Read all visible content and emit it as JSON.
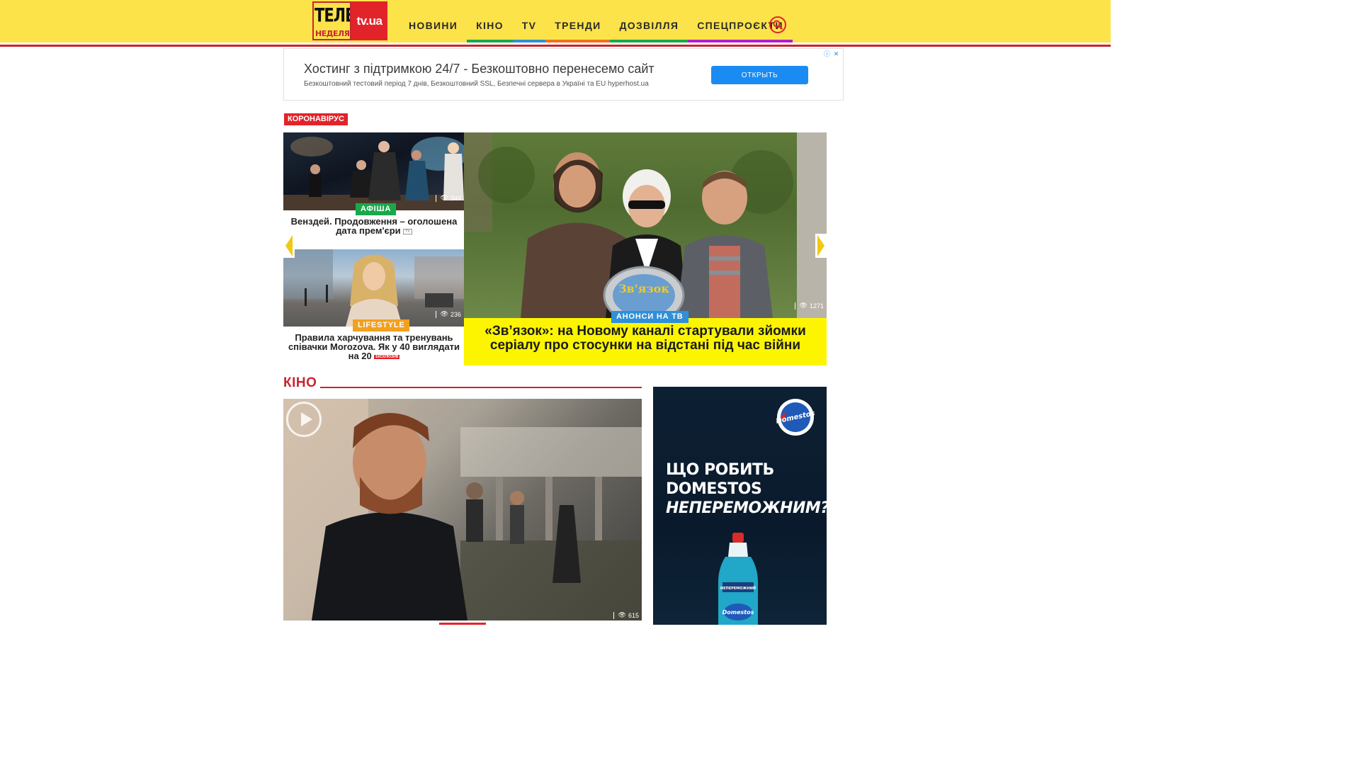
{
  "header": {
    "logo_top": "ТЕЛЕ",
    "logo_bottom": "НЕДЕЛЯ",
    "logo_right": "tv.ua",
    "nav": [
      {
        "label": "НОВИНИ",
        "color": "#fde34a"
      },
      {
        "label": "КІНО",
        "color": "#1aa84c"
      },
      {
        "label": "TV",
        "color": "#2f8fd8"
      },
      {
        "label": "ТРЕНДИ",
        "color": "#f2701f"
      },
      {
        "label": "ДОЗВІЛЛЯ",
        "color": "#1aa84c"
      },
      {
        "label": "СПЕЦПРОЄКТИ",
        "color": "#b31fc9"
      }
    ]
  },
  "ad_top": {
    "title": "Хостинг з підтримкою 24/7 - Безкоштовно перенесемо сайт",
    "subtitle": "Безкоштовний тестовий період 7 днів, Безкоштовний SSL, Безпечні сервера в Україні та EU hyperhost.ua",
    "button": "ОТКРЫТЬ"
  },
  "topic_tag": "КОРОНАВІРУС",
  "slider": {
    "small_cards": [
      {
        "badge": "АФІША",
        "badge_color": "#1aa84c",
        "title": "Венздей. Продовження – оголошена дата прем'єри",
        "mini_tag": "TV",
        "mini_tag_color": "#ffffff",
        "views": "344"
      },
      {
        "badge": "LIFESTYLE",
        "badge_color": "#f2a01f",
        "title": "Правила харчування та тренувань співачки Morozova. Як у 40 виглядати на 20",
        "mini_tag": "ЕКСКЛЮЗИВ",
        "mini_tag_color": "#e2232a",
        "views": "236"
      }
    ],
    "featured": {
      "badge": "АНОНСИ НА ТВ",
      "badge_color": "#2f8fd8",
      "title": "«Зв’язок»: на Новому каналі стартували зйомки серіалу про стосунки на відстані під час війни",
      "views": "1271",
      "sign_text": "Зв'язок"
    }
  },
  "kino": {
    "heading": "КІНО",
    "views": "615"
  },
  "side_ad": {
    "brand": "Domestos",
    "line1": "ЩО РОБИТЬ",
    "line2": "DOMESTOS",
    "line3": "НЕПЕРЕМОЖНИМ?",
    "bottle_label": "НЕПЕРЕМОЖНИЙ",
    "bottle_brand": "Domestos"
  }
}
